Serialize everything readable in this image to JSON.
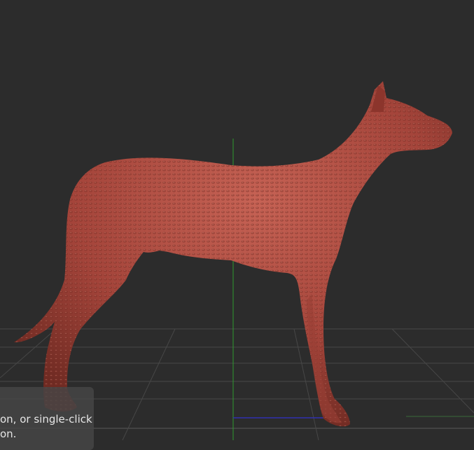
{
  "viewport": {
    "background": "#2c2c2c",
    "model_color": "#a8463a",
    "axis_colors": {
      "y": "#2e9a2e",
      "x": "#2a2a9a",
      "grid": "#444444"
    }
  },
  "tooltip": {
    "line1": "on, or single-click",
    "line2": "on."
  }
}
